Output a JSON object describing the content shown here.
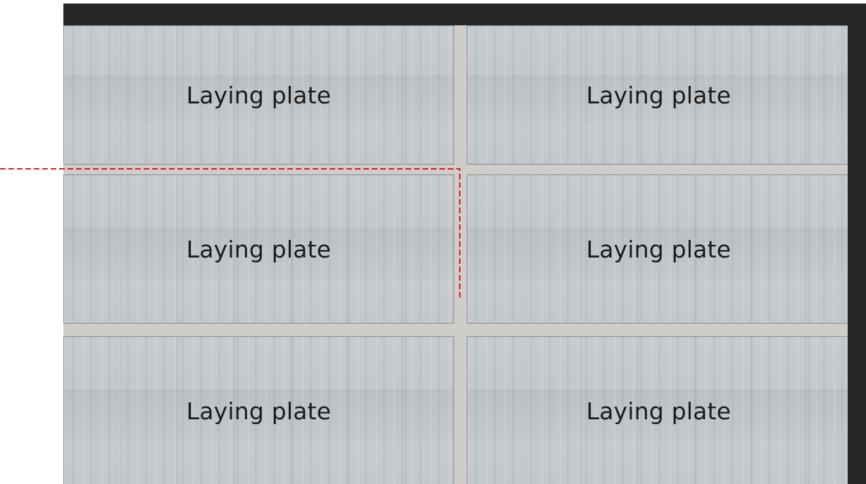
{
  "plates": [
    {
      "label": "Laying plate"
    },
    {
      "label": "Laying plate"
    },
    {
      "label": "Laying plate"
    },
    {
      "label": "Laying plate"
    },
    {
      "label": "Laying plate"
    },
    {
      "label": "Laying plate"
    }
  ],
  "colors": {
    "frame": "#262626",
    "plate": "#c3c8cd",
    "grout": "#cfcdc9",
    "guide_line": "#e8161b"
  }
}
